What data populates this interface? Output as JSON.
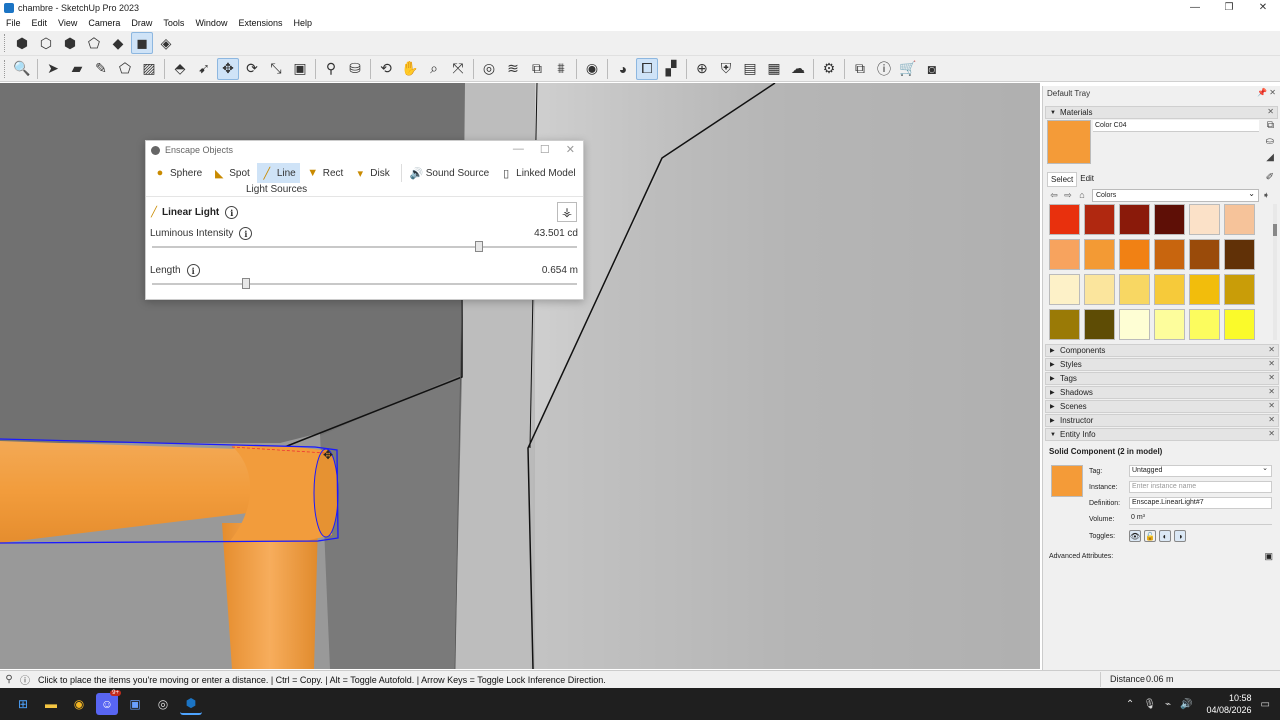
{
  "window": {
    "title": "chambre - SketchUp Pro 2023",
    "controls": [
      "—",
      "❐",
      "✕"
    ]
  },
  "menu": [
    "File",
    "Edit",
    "View",
    "Camera",
    "Draw",
    "Tools",
    "Window",
    "Extensions",
    "Help"
  ],
  "toolbar1": [
    "iso-view-icon",
    "top-view-icon",
    "front-view-icon",
    "right-view-icon",
    "back-view-icon",
    "shaded-icon",
    "textured-icon"
  ],
  "toolbar2": [
    "zoom-icon",
    "select-icon",
    "eraser-icon",
    "pencil-icon",
    "shapes-icon",
    "pushpull-icon",
    "paint-icon",
    "move-icon",
    "rotate-icon",
    "scale-icon",
    "offset-icon",
    "tape-icon",
    "dimension-icon",
    "orbit-icon",
    "pan-icon",
    "zoom-window-icon",
    "zoom-extents-icon",
    "section-icon",
    "layers-icon",
    "sandbox-icon",
    "profile-icon",
    "enscape-render-icon",
    "enscape-sync-icon",
    "enscape-capture-icon",
    "enscape-objects-icon",
    "enscape-assets-icon",
    "enscape-materials-icon",
    "enscape-views-icon",
    "enscape-upload-icon",
    "enscape-settings-icon",
    "enscape-window-icon",
    "enscape-info-icon",
    "warehouse-icon",
    "account-icon"
  ],
  "enscape": {
    "title": "Enscape Objects",
    "tabs": [
      {
        "label": "Sphere",
        "icon": "●"
      },
      {
        "label": "Spot",
        "icon": "◣"
      },
      {
        "label": "Line",
        "icon": "╱"
      },
      {
        "label": "Rect",
        "icon": "▼"
      },
      {
        "label": "Disk",
        "icon": "▾"
      }
    ],
    "tabs_extra": [
      {
        "label": "Sound Source",
        "icon": "🔊"
      },
      {
        "label": "Linked Model",
        "icon": "▯"
      }
    ],
    "group_label": "Light Sources",
    "heading": "Linear Light",
    "intensity_label": "Luminous Intensity",
    "intensity_value": "43.501 cd",
    "intensity_fraction": 0.77,
    "length_label": "Length",
    "length_value": "0.654 m",
    "length_fraction": 0.22
  },
  "status": {
    "message": "Click to place the items you're moving or enter a distance. | Ctrl = Copy. | Alt = Toggle Autofold. | Arrow Keys = Toggle Lock Inference Direction.",
    "distance_label": "Distance",
    "distance_value": "0.06 m"
  },
  "tray": {
    "title": "Default Tray",
    "materials_label": "Materials",
    "material_name": "Color C04",
    "material_color": "#f49b38",
    "select_label": "Select",
    "edit_label": "Edit",
    "library": "Colors",
    "palette": [
      "#e8300d",
      "#b02810",
      "#8a1a0a",
      "#5e0f06",
      "#fbe1c8",
      "#f6c39a",
      "#f7a35e",
      "#f39a34",
      "#f18114",
      "#c8650e",
      "#9a4b0a",
      "#613107",
      "#fdf1c8",
      "#fbe59d",
      "#f8d763",
      "#f6ca3a",
      "#f2bd0c",
      "#c99d08",
      "#9a7a06",
      "#5e4c05",
      "#fefed4",
      "#fdfd9c",
      "#fcfc5e",
      "#fafa2a"
    ],
    "panels": [
      "Components",
      "Styles",
      "Tags",
      "Shadows",
      "Scenes",
      "Instructor"
    ],
    "entity_label": "Entity Info",
    "entity_title": "Solid Component (2 in model)",
    "tag_label": "Tag:",
    "tag_value": "Untagged",
    "instance_label": "Instance:",
    "instance_placeholder": "Enter instance name",
    "definition_label": "Definition:",
    "definition_value": "Enscape.LinearLight#7",
    "volume_label": "Volume:",
    "volume_value": "0 m³",
    "toggles_label": "Toggles:",
    "advanced_label": "Advanced Attributes:"
  },
  "taskbar": {
    "apps": [
      "windows-start-icon",
      "file-explorer-icon",
      "chrome-icon",
      "discord-icon",
      "app-icon",
      "obs-icon",
      "sketchup-icon"
    ],
    "discord_badge": "9+",
    "time": "10:58",
    "date": "04/08/2026"
  }
}
